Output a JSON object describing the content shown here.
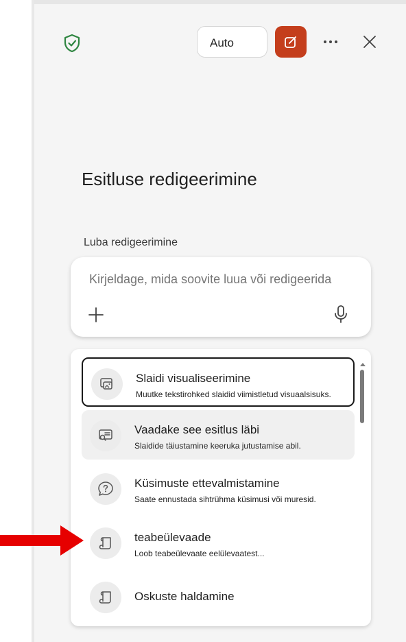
{
  "header": {
    "mode_button_label": "Auto",
    "shield_icon": "shield-check-icon",
    "new_chat_icon": "compose-icon",
    "more_icon": "ellipsis-icon",
    "close_icon": "close-icon"
  },
  "main": {
    "title": "Esitluse redigeerimine",
    "mode_label": "Luba redigeerimine"
  },
  "composer": {
    "placeholder": "Kirjeldage, mida soovite luua või redigeerida",
    "add_icon": "plus-icon",
    "mic_icon": "microphone-icon"
  },
  "suggestions": [
    {
      "title": "Slaidi visualiseerimine",
      "description": "Muutke tekstirohked slaidid viimistletud visuaalsisuks.",
      "icon": "slide-image-icon",
      "state": "selected"
    },
    {
      "title": "Vaadake see esitlus läbi",
      "description": "Slaidide täiustamine keeruka jutustamise abil.",
      "icon": "slide-review-icon",
      "state": "hover"
    },
    {
      "title": "Küsimuste ettevalmistamine",
      "description": "Saate ennustada sihtrühma küsimusi või muresid.",
      "icon": "chat-question-icon",
      "state": "normal"
    },
    {
      "title": "teabeülevaade",
      "description": "Loob teabeülevaate eelülevaatest...",
      "icon": "scroll-icon",
      "state": "normal"
    },
    {
      "title": "Oskuste haldamine",
      "description": "",
      "icon": "scroll-icon",
      "state": "normal"
    }
  ],
  "colors": {
    "accent": "#c43e1c",
    "shield": "#2e8540",
    "arrow": "#e60000"
  }
}
